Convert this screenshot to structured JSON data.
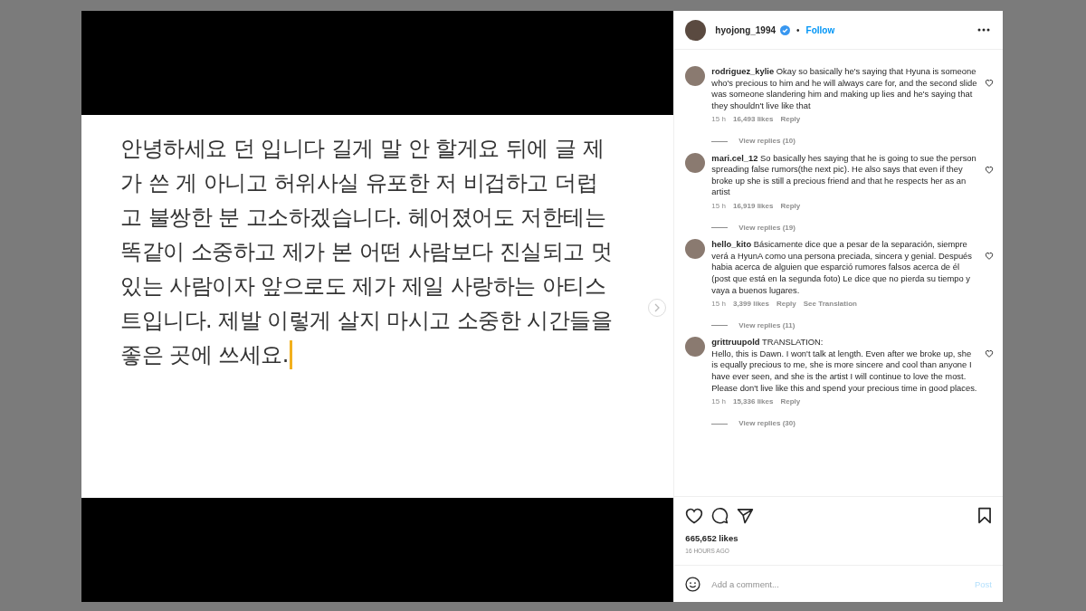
{
  "post_image": {
    "lines": [
      "안녕하세요 던 입니다 길게 말 안 할게요 뒤에 글 제",
      "가 쓴 게 아니고 허위사실 유포한 저 비겁하고 더럽",
      "고 불쌍한 분 고소하겠습니다. 헤어졌어도 저한테는",
      "똑같이 소중하고 제가 본 어떤 사람보다 진실되고 멋",
      "있는 사람이자 앞으로도 제가 제일 사랑하는 아티스",
      "트입니다. 제발 이렇게 살지 마시고 소중한 시간들을",
      "좋은 곳에 쓰세요."
    ],
    "text_cursor": true
  },
  "header": {
    "username": "hyojong_1994",
    "verified": true,
    "separator": "•",
    "follow": "Follow"
  },
  "comments": [
    {
      "username": "rodriguez_kylie",
      "text": "Okay so basically he's saying that Hyuna is someone who's precious to him and he will always care for, and the second slide was someone slandering him and making up lies and he's saying that they shouldn't live like that",
      "time": "15 h",
      "likes": "16,493 likes",
      "reply": "Reply",
      "view_replies": "View replies (10)"
    },
    {
      "username": "mari.cel_12",
      "text": "So basically hes saying that he is going to sue the person spreading false rumors(the next pic). He also says that even if they broke up she is still a precious friend and that he respects her as an artist",
      "time": "15 h",
      "likes": "16,919 likes",
      "reply": "Reply",
      "view_replies": "View replies (19)"
    },
    {
      "username": "hello_kito",
      "text": "Básicamente dice que a pesar de la separación, siempre verá a HyunA como una persona preciada, sincera y genial. Después habia acerca de alguien que esparció rumores falsos acerca de él (post que está en la segunda foto) Le dice que no pierda su tiempo y vaya a buenos lugares.",
      "time": "15 h",
      "likes": "3,399 likes",
      "reply": "Reply",
      "translate": "See Translation",
      "view_replies": "View replies (11)"
    },
    {
      "username": "grittruupold",
      "text": "TRANSLATION:\nHello, this is Dawn. I won't talk at length. Even after we broke up, she is equally precious to me, she is more sincere and cool than anyone I have ever seen, and she is the artist I will continue to love the most. Please don't live like this and spend your precious time in good places.",
      "time": "15 h",
      "likes": "15,336 likes",
      "reply": "Reply",
      "view_replies": "View replies (30)"
    }
  ],
  "likes": "665,652 likes",
  "posted": "16 HOURS AGO",
  "comment_box": {
    "placeholder": "Add a comment...",
    "post": "Post",
    "post_enabled": false
  }
}
